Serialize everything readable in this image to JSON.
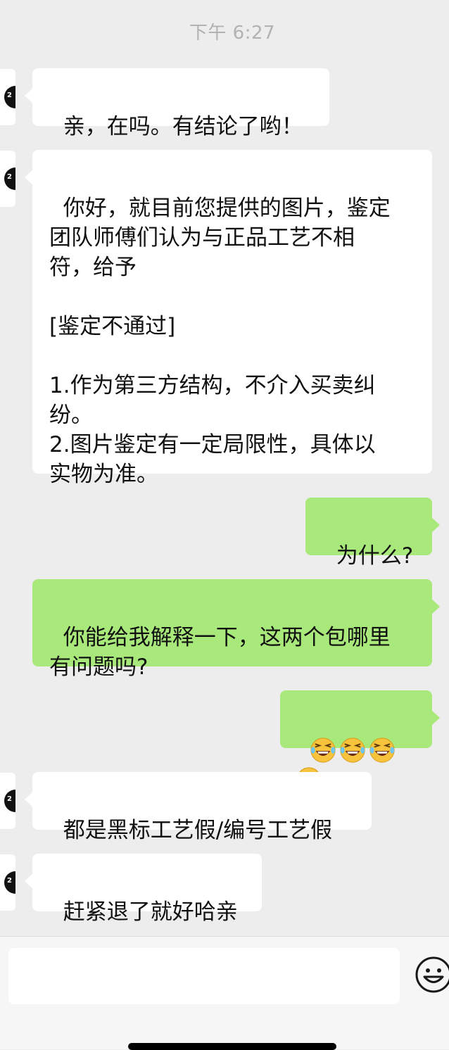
{
  "timestamp": "下午 6:27",
  "messages": [
    {
      "from": "them",
      "text": "亲，在吗。有结论了哟！"
    },
    {
      "from": "them",
      "text": "你好，就目前您提供的图片，鉴定\n团队师傅们认为与正品工艺不相\n符，给予\n\n[鉴定不通过]\n\n1.作为第三方结构，不介入买卖纠\n纷。\n2.图片鉴定有一定局限性，具体以\n实物为准。"
    },
    {
      "from": "me",
      "text": "为什么?"
    },
    {
      "from": "me",
      "text": "你能给我解释一下，这两个包哪里\n有问题吗?"
    },
    {
      "from": "me",
      "emoji": "laugh-crying-emoji",
      "emoji_count": 4
    },
    {
      "from": "them",
      "text": "都是黑标工艺假/编号工艺假"
    },
    {
      "from": "them",
      "text": "赶紧退了就好哈亲"
    }
  ],
  "avatar_mark": "2",
  "input": {
    "value": "",
    "emoji_button_icon": "smiley-face-icon"
  },
  "colors": {
    "background": "#ededed",
    "incoming_bubble": "#ffffff",
    "outgoing_bubble": "#a9e97b"
  }
}
